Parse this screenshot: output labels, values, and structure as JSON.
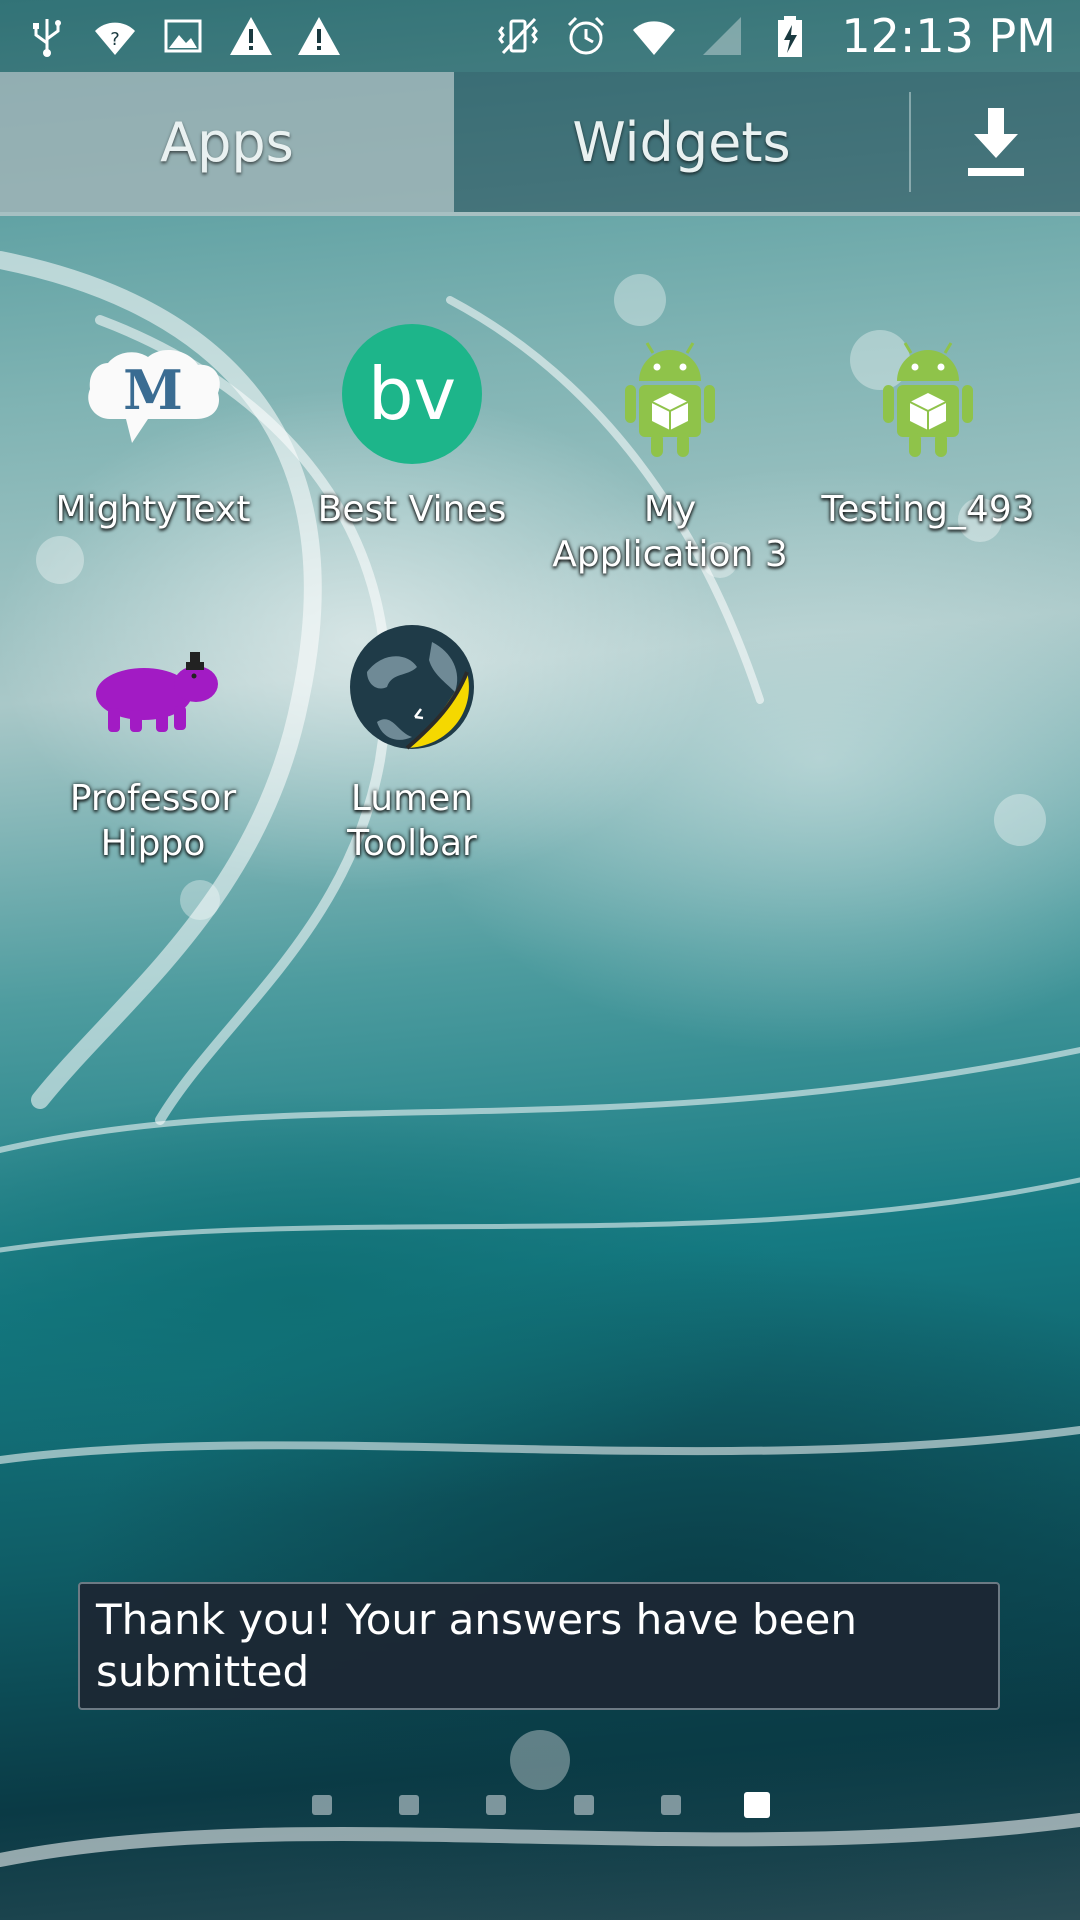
{
  "status_bar": {
    "left_icons": [
      "usb-icon",
      "wifi-question-icon",
      "image-icon",
      "warning-icon",
      "warning-icon"
    ],
    "right_icons": [
      "mute-vibrate-icon",
      "alarm-icon",
      "wifi-icon",
      "signal-icon",
      "battery-charging-icon"
    ],
    "time": "12:13 PM"
  },
  "tabs": {
    "apps": "Apps",
    "widgets": "Widgets",
    "download_icon": "download-icon"
  },
  "apps": [
    {
      "label": "MightyText",
      "icon": "mightytext-icon"
    },
    {
      "label": "Best Vines",
      "icon": "best-vines-icon"
    },
    {
      "label": "My Application 3",
      "icon": "android-icon"
    },
    {
      "label": "Testing_493",
      "icon": "android-icon"
    },
    {
      "label": "Professor Hippo",
      "icon": "hippo-icon"
    },
    {
      "label": "Lumen Toolbar",
      "icon": "lumen-toolbar-icon"
    }
  ],
  "toast": {
    "message": "Thank you! Your answers have been submitted"
  },
  "pager": {
    "total_pages": 6,
    "active_page": 6
  },
  "colors": {
    "toast_bg": "#1c2834",
    "best_vines_green": "#1db58a",
    "android_green": "#8fc34a",
    "hippo_purple": "#a21bc4"
  }
}
